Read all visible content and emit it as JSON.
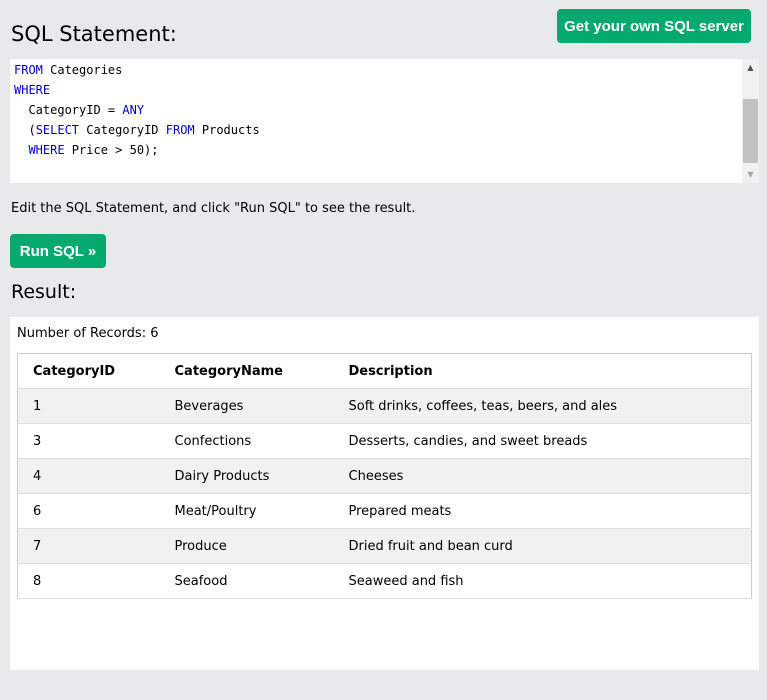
{
  "header": {
    "title": "SQL Statement:",
    "own_server_label": "Get your own SQL server"
  },
  "editor": {
    "lines": [
      [
        {
          "t": "FROM",
          "kw": true
        },
        {
          "t": " Categories"
        }
      ],
      [
        {
          "t": "WHERE",
          "kw": true
        }
      ],
      [
        {
          "t": "  CategoryID = "
        },
        {
          "t": "ANY",
          "kw": true
        }
      ],
      [
        {
          "t": "  ("
        },
        {
          "t": "SELECT",
          "kw": true
        },
        {
          "t": " CategoryID "
        },
        {
          "t": "FROM",
          "kw": true
        },
        {
          "t": " Products"
        }
      ],
      [
        {
          "t": "  "
        },
        {
          "t": "WHERE",
          "kw": true
        },
        {
          "t": " Price > 50);"
        }
      ]
    ],
    "keyword_color": "#0000cd"
  },
  "instructions": "Edit the SQL Statement, and click \"Run SQL\" to see the result.",
  "run_button_label": "Run SQL »",
  "result": {
    "heading": "Result:",
    "record_count": "Number of Records: 6",
    "columns": [
      "CategoryID",
      "CategoryName",
      "Description"
    ],
    "rows": [
      [
        "1",
        "Beverages",
        "Soft drinks, coffees, teas, beers, and ales"
      ],
      [
        "3",
        "Confections",
        "Desserts, candies, and sweet breads"
      ],
      [
        "4",
        "Dairy Products",
        "Cheeses"
      ],
      [
        "6",
        "Meat/Poultry",
        "Prepared meats"
      ],
      [
        "7",
        "Produce",
        "Dried fruit and bean curd"
      ],
      [
        "8",
        "Seafood",
        "Seaweed and fish"
      ]
    ]
  },
  "colors": {
    "accent": "#04aa6d",
    "background": "#e7e9eb",
    "row_stripe": "#f1f1f1"
  },
  "icons": {
    "scroll_up": "scroll-up-arrow-icon",
    "scroll_down": "scroll-down-arrow-icon"
  }
}
